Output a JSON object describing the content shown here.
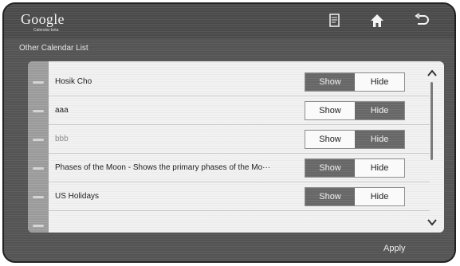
{
  "header": {
    "logo_text": "Google",
    "logo_subtext": "Calendar beta",
    "icons": [
      "note-icon",
      "home-icon",
      "back-icon"
    ]
  },
  "page": {
    "subtitle": "Other Calendar List",
    "apply_label": "Apply"
  },
  "calendars": [
    {
      "name": "Hosik Cho",
      "state": "Show",
      "show_label": "Show",
      "hide_label": "Hide"
    },
    {
      "name": "aaa",
      "state": "Hide",
      "show_label": "Show",
      "hide_label": "Hide"
    },
    {
      "name": "bbb",
      "state": "Hide",
      "show_label": "Show",
      "hide_label": "Hide"
    },
    {
      "name": "Phases of the Moon - Shows the primary phases of the Mo···",
      "state": "Show",
      "show_label": "Show",
      "hide_label": "Hide"
    },
    {
      "name": "US Holidays",
      "state": "Show",
      "show_label": "Show",
      "hide_label": "Hide"
    }
  ]
}
